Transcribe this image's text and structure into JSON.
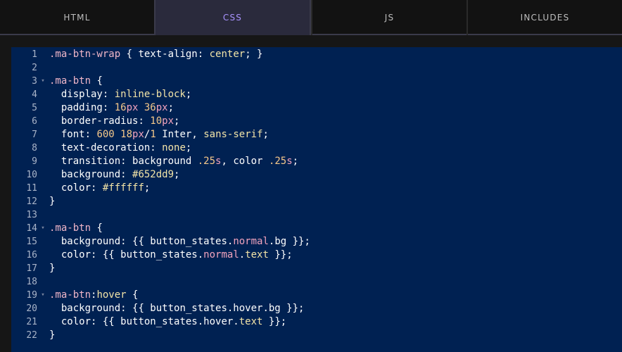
{
  "tabs": [
    {
      "label": "HTML",
      "active": false
    },
    {
      "label": "CSS",
      "active": true
    },
    {
      "label": "JS",
      "active": false
    },
    {
      "label": "INCLUDES",
      "active": false
    }
  ],
  "colors": {
    "editor_bg": "#002152",
    "active_tab_text": "#a993ff",
    "active_tab_bg": "#2a2a3c",
    "selector": "#f0b6c8",
    "value": "#f3e4a8",
    "number": "#f6c98a",
    "unit": "#f2a3bd"
  },
  "editor": {
    "language": "css",
    "lines": [
      {
        "num": "1",
        "fold": "",
        "tokens": [
          {
            "t": "selector",
            "v": ".ma-btn-wrap"
          },
          {
            "t": "punct",
            "v": " { "
          },
          {
            "t": "prop",
            "v": "text-align"
          },
          {
            "t": "punct",
            "v": ": "
          },
          {
            "t": "keyword",
            "v": "center"
          },
          {
            "t": "punct",
            "v": "; }"
          }
        ]
      },
      {
        "num": "2",
        "fold": "",
        "tokens": []
      },
      {
        "num": "3",
        "fold": "▾",
        "tokens": [
          {
            "t": "selector",
            "v": ".ma-btn"
          },
          {
            "t": "punct",
            "v": " {"
          }
        ]
      },
      {
        "num": "4",
        "fold": "",
        "tokens": [
          {
            "t": "prop",
            "v": "  display"
          },
          {
            "t": "punct",
            "v": ": "
          },
          {
            "t": "keyword",
            "v": "inline-block"
          },
          {
            "t": "punct",
            "v": ";"
          }
        ]
      },
      {
        "num": "5",
        "fold": "",
        "tokens": [
          {
            "t": "prop",
            "v": "  padding"
          },
          {
            "t": "punct",
            "v": ": "
          },
          {
            "t": "number",
            "v": "16"
          },
          {
            "t": "unit",
            "v": "px"
          },
          {
            "t": "punct",
            "v": " "
          },
          {
            "t": "number",
            "v": "36"
          },
          {
            "t": "unit",
            "v": "px"
          },
          {
            "t": "punct",
            "v": ";"
          }
        ]
      },
      {
        "num": "6",
        "fold": "",
        "tokens": [
          {
            "t": "prop",
            "v": "  border-radius"
          },
          {
            "t": "punct",
            "v": ": "
          },
          {
            "t": "number",
            "v": "10"
          },
          {
            "t": "unit",
            "v": "px"
          },
          {
            "t": "punct",
            "v": ";"
          }
        ]
      },
      {
        "num": "7",
        "fold": "",
        "tokens": [
          {
            "t": "prop",
            "v": "  font"
          },
          {
            "t": "punct",
            "v": ": "
          },
          {
            "t": "number",
            "v": "600"
          },
          {
            "t": "punct",
            "v": " "
          },
          {
            "t": "number",
            "v": "18"
          },
          {
            "t": "unit",
            "v": "px"
          },
          {
            "t": "punct",
            "v": "/"
          },
          {
            "t": "number",
            "v": "1"
          },
          {
            "t": "punct",
            "v": " "
          },
          {
            "t": "string",
            "v": "Inter"
          },
          {
            "t": "punct",
            "v": ", "
          },
          {
            "t": "keyword",
            "v": "sans-serif"
          },
          {
            "t": "punct",
            "v": ";"
          }
        ]
      },
      {
        "num": "8",
        "fold": "",
        "tokens": [
          {
            "t": "prop",
            "v": "  text-decoration"
          },
          {
            "t": "punct",
            "v": ": "
          },
          {
            "t": "keyword",
            "v": "none"
          },
          {
            "t": "punct",
            "v": ";"
          }
        ]
      },
      {
        "num": "9",
        "fold": "",
        "tokens": [
          {
            "t": "prop",
            "v": "  transition"
          },
          {
            "t": "punct",
            "v": ": "
          },
          {
            "t": "string",
            "v": "background"
          },
          {
            "t": "punct",
            "v": " "
          },
          {
            "t": "number",
            "v": ".25"
          },
          {
            "t": "unit",
            "v": "s"
          },
          {
            "t": "punct",
            "v": ", "
          },
          {
            "t": "string",
            "v": "color"
          },
          {
            "t": "punct",
            "v": " "
          },
          {
            "t": "number",
            "v": ".25"
          },
          {
            "t": "unit",
            "v": "s"
          },
          {
            "t": "punct",
            "v": ";"
          }
        ]
      },
      {
        "num": "10",
        "fold": "",
        "tokens": [
          {
            "t": "prop",
            "v": "  background"
          },
          {
            "t": "punct",
            "v": ": "
          },
          {
            "t": "value",
            "v": "#652dd9"
          },
          {
            "t": "punct",
            "v": ";"
          }
        ]
      },
      {
        "num": "11",
        "fold": "",
        "tokens": [
          {
            "t": "prop",
            "v": "  color"
          },
          {
            "t": "punct",
            "v": ": "
          },
          {
            "t": "value",
            "v": "#ffffff"
          },
          {
            "t": "punct",
            "v": ";"
          }
        ]
      },
      {
        "num": "12",
        "fold": "",
        "tokens": [
          {
            "t": "brace",
            "v": "}"
          }
        ]
      },
      {
        "num": "13",
        "fold": "",
        "tokens": []
      },
      {
        "num": "14",
        "fold": "▾",
        "tokens": [
          {
            "t": "selector",
            "v": ".ma-btn"
          },
          {
            "t": "punct",
            "v": " {"
          }
        ]
      },
      {
        "num": "15",
        "fold": "",
        "tokens": [
          {
            "t": "prop",
            "v": "  background"
          },
          {
            "t": "punct",
            "v": ": "
          },
          {
            "t": "template",
            "v": "{{ button_states."
          },
          {
            "t": "accent",
            "v": "normal"
          },
          {
            "t": "template",
            "v": ".bg }}"
          },
          {
            "t": "punct",
            "v": ";"
          }
        ]
      },
      {
        "num": "16",
        "fold": "",
        "tokens": [
          {
            "t": "prop",
            "v": "  color"
          },
          {
            "t": "punct",
            "v": ": "
          },
          {
            "t": "template",
            "v": "{{ button_states."
          },
          {
            "t": "accent",
            "v": "normal"
          },
          {
            "t": "template",
            "v": "."
          },
          {
            "t": "keyword",
            "v": "text"
          },
          {
            "t": "template",
            "v": " }}"
          },
          {
            "t": "punct",
            "v": ";"
          }
        ]
      },
      {
        "num": "17",
        "fold": "",
        "tokens": [
          {
            "t": "brace",
            "v": "}"
          }
        ]
      },
      {
        "num": "18",
        "fold": "",
        "tokens": []
      },
      {
        "num": "19",
        "fold": "▾",
        "tokens": [
          {
            "t": "selector",
            "v": ".ma-btn"
          },
          {
            "t": "punct",
            "v": ":"
          },
          {
            "t": "keyword",
            "v": "hover"
          },
          {
            "t": "punct",
            "v": " {"
          }
        ]
      },
      {
        "num": "20",
        "fold": "",
        "tokens": [
          {
            "t": "prop",
            "v": "  background"
          },
          {
            "t": "punct",
            "v": ": "
          },
          {
            "t": "template",
            "v": "{{ button_states.hover.bg }}"
          },
          {
            "t": "punct",
            "v": ";"
          }
        ]
      },
      {
        "num": "21",
        "fold": "",
        "tokens": [
          {
            "t": "prop",
            "v": "  color"
          },
          {
            "t": "punct",
            "v": ": "
          },
          {
            "t": "template",
            "v": "{{ button_states.hover."
          },
          {
            "t": "keyword",
            "v": "text"
          },
          {
            "t": "template",
            "v": " }}"
          },
          {
            "t": "punct",
            "v": ";"
          }
        ]
      },
      {
        "num": "22",
        "fold": "",
        "tokens": [
          {
            "t": "brace",
            "v": "}"
          }
        ]
      }
    ]
  }
}
